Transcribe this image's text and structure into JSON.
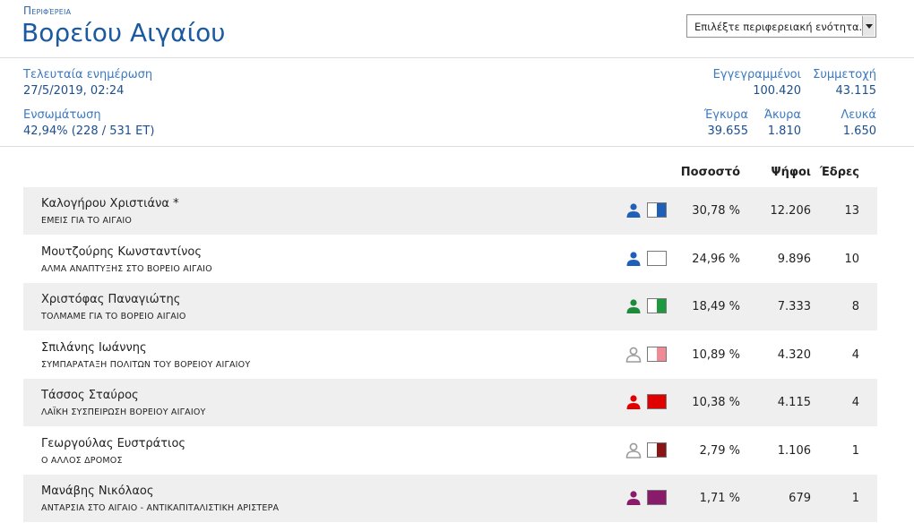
{
  "header": {
    "kicker": "Περιφέρεια",
    "title": "Βορείου Αιγαίου",
    "select_value": "Επιλέξτε περιφερειακή ενότητα..."
  },
  "stats": {
    "last_update_label": "Τελευταία ενημέρωση",
    "last_update_value": "27/5/2019, 02:24",
    "integration_label": "Ενσωμάτωση",
    "integration_value": "42,94% (228 / 531 ΕΤ)",
    "registered_label": "Εγγεγραμμένοι",
    "registered_value": "100.420",
    "turnout_label": "Συμμετοχή",
    "turnout_value": "43.115",
    "valid_label": "Έγκυρα",
    "valid_value": "39.655",
    "invalid_label": "Άκυρα",
    "invalid_value": "1.810",
    "blank_label": "Λευκά",
    "blank_value": "1.650"
  },
  "columns": {
    "percent": "Ποσοστό",
    "votes": "Ψήφοι",
    "seats": "Έδρες"
  },
  "colors": {
    "accent": "#1b5aa1",
    "label": "#3d79bf",
    "row_shade": "#efefef"
  },
  "rows": [
    {
      "name": "Καλογήρου Χριστιάνα *",
      "party": "ΕΜΕΙΣ ΓΙΑ ΤΟ ΑΙΓΑΙΟ",
      "percent": "30,78 %",
      "votes": "12.206",
      "seats": "13",
      "person_color": "#1f5fb8",
      "swatch_color": "#1f5fb8",
      "swatch_fill": 0.5
    },
    {
      "name": "Μουτζούρης Κωνσταντίνος",
      "party": "ΑΛΜΑ ΑΝΑΠΤΥΞΗΣ ΣΤΟ ΒΟΡΕΙΟ ΑΙΓΑΙΟ",
      "percent": "24,96 %",
      "votes": "9.896",
      "seats": "10",
      "person_color": "#1f5fb8",
      "swatch_color": "#ffffff",
      "swatch_fill": 0
    },
    {
      "name": "Χριστόφας Παναγιώτης",
      "party": "ΤΟΛΜΑΜΕ ΓΙΑ ΤΟ ΒΟΡΕΙΟ ΑΙΓΑΙΟ",
      "percent": "18,49 %",
      "votes": "7.333",
      "seats": "8",
      "person_color": "#1e8a3c",
      "swatch_color": "#1e9a3e",
      "swatch_fill": 0.5
    },
    {
      "name": "Σπιλάνης Ιωάννης",
      "party": "ΣΥΜΠΑΡΑΤΑΞΗ ΠΟΛΙΤΩΝ ΤΟΥ ΒΟΡΕΙΟΥ ΑΙΓΑΙΟΥ",
      "percent": "10,89 %",
      "votes": "4.320",
      "seats": "4",
      "person_color": "#9a9a9a",
      "person_outline": true,
      "swatch_color": "#f08a96",
      "swatch_fill": 0.5
    },
    {
      "name": "Τάσσος Σταύρος",
      "party": "ΛΑΪΚΗ ΣΥΣΠΕΙΡΩΣΗ ΒΟΡΕΙΟΥ ΑΙΓΑΙΟΥ",
      "percent": "10,38 %",
      "votes": "4.115",
      "seats": "4",
      "person_color": "#e00000",
      "swatch_color": "#e00000",
      "swatch_fill": 1
    },
    {
      "name": "Γεωργούλας Ευστράτιος",
      "party": "Ο ΑΛΛΟΣ ΔΡΟΜΟΣ",
      "percent": "2,79 %",
      "votes": "1.106",
      "seats": "1",
      "person_color": "#9a9a9a",
      "person_outline": true,
      "swatch_color": "#8a1416",
      "swatch_fill": 0.5
    },
    {
      "name": "Μανάβης Νικόλαος",
      "party": "ΑΝΤΑΡΣΙΑ ΣΤΟ ΑΙΓΑΙΟ - ΑΝΤΙΚΑΠΙΤΑΛΙΣΤΙΚΗ ΑΡΙΣΤΕΡΑ",
      "percent": "1,71 %",
      "votes": "679",
      "seats": "1",
      "person_color": "#8a1a6a",
      "swatch_color": "#8a1a6a",
      "swatch_fill": 1
    }
  ]
}
